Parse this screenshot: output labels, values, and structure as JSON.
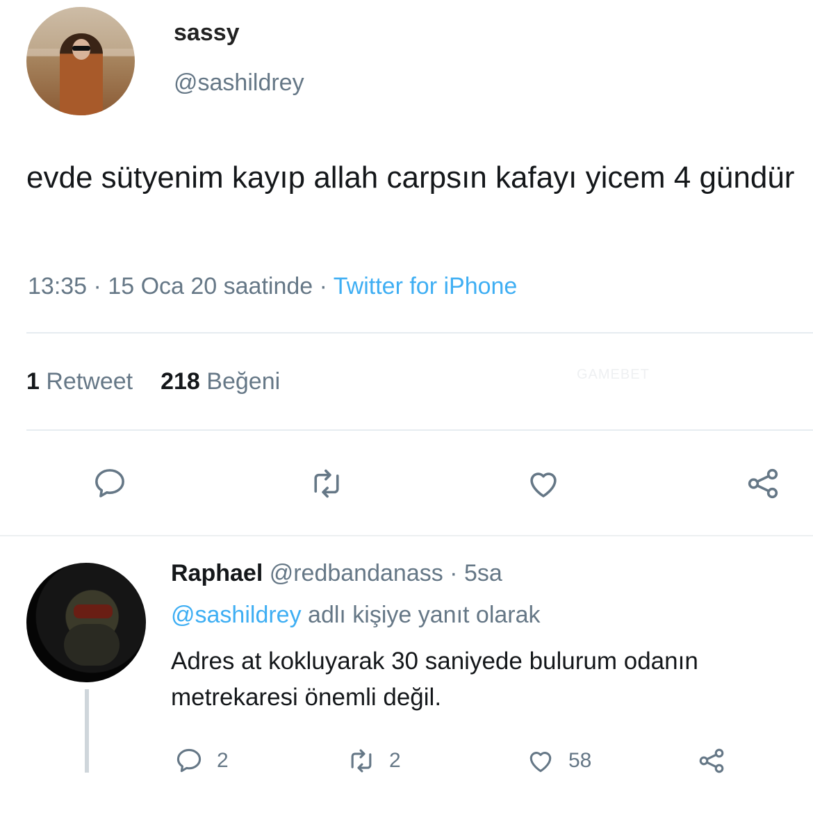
{
  "tweet": {
    "display_name": "sassy",
    "handle": "@sashildrey",
    "text": "evde sütyenim kayıp allah carpsın kafayı yicem 4 gündür",
    "time": "13:35 · 15 Oca 20 saatinde · ",
    "source": "Twitter for iPhone",
    "retweet_count": "1",
    "retweet_label": "Retweet",
    "like_count": "218",
    "like_label": "Beğeni",
    "actions": [
      "reply-icon",
      "retweet-icon",
      "heart-icon",
      "share-icon"
    ]
  },
  "watermark": "GAMEBET",
  "reply": {
    "display_name": "Raphael",
    "handle_time": " @redbandanass · 5sa",
    "mention": "@sashildrey",
    "reply_to_suffix": " adlı kişiye yanıt olarak",
    "text": "Adres at kokluyarak 30 saniyede bulurum odanın metrekaresi önemli değil.",
    "reply_count": "2",
    "retweet_count": "2",
    "like_count": "58"
  },
  "colors": {
    "accent": "#1da1f2",
    "muted": "#657786",
    "text": "#14171a"
  }
}
